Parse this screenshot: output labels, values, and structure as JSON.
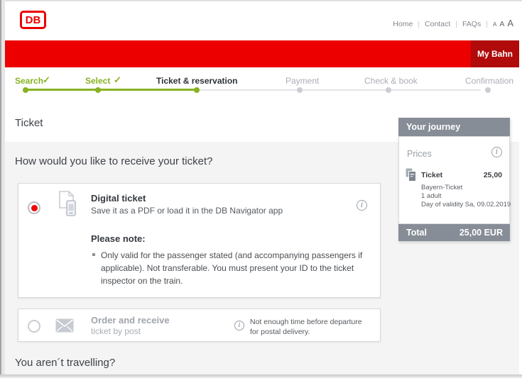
{
  "colors": {
    "db_red": "#ec0000",
    "db_red_dark": "#b00a0a",
    "progress_green": "#87b221",
    "panel_gray": "#878d96",
    "background_gray": "#f4f4f5"
  },
  "header": {
    "logo": "DB",
    "sep": "|",
    "nav": [
      {
        "label": "Home"
      },
      {
        "label": "Contact"
      },
      {
        "label": "FAQs"
      }
    ],
    "font_sizes": [
      "A",
      "A",
      "A"
    ],
    "my_bahn": "My Bahn"
  },
  "progress": {
    "check": "✓",
    "steps": [
      {
        "label": "Search",
        "state": "done"
      },
      {
        "label": "Select",
        "state": "done"
      },
      {
        "label": "Ticket & reservation",
        "state": "current"
      },
      {
        "label": "Payment",
        "state": "upcoming"
      },
      {
        "label": "Check & book",
        "state": "upcoming"
      },
      {
        "label": "Confirmation",
        "state": "upcoming"
      }
    ]
  },
  "page": {
    "title": "Ticket",
    "question": "How would you like to receive your ticket?",
    "footer_question": "You aren´t travelling?"
  },
  "options": {
    "info_glyph": "i",
    "digital": {
      "selected": true,
      "title": "Digital ticket",
      "subtitle": "Save it as a PDF or load it in the DB Navigator app",
      "note_title": "Please note:",
      "note_text": "Only valid for the passenger stated (and accompanying passengers if applicable). Not transferable. You must present your ID to the ticket inspector on the train."
    },
    "post": {
      "selected": false,
      "title": "Order and receive",
      "subtitle": "ticket by post",
      "info": "Not enough time before departure for postal delivery."
    }
  },
  "journey": {
    "title": "Your journey",
    "prices_label": "Prices",
    "item": {
      "label": "Ticket",
      "price": "25,00",
      "lines": [
        "Bayern-Ticket",
        "1 adult",
        "Day of validity Sa, 09.02.2019"
      ]
    },
    "total_label": "Total",
    "total_value": "25,00 EUR"
  }
}
